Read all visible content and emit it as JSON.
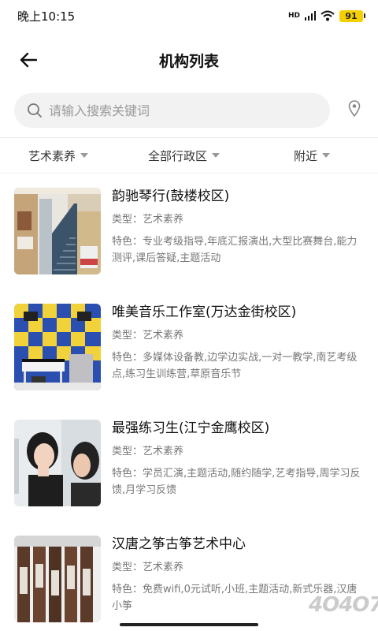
{
  "status_bar": {
    "time": "晚上10:15",
    "network": "HD",
    "battery": "91"
  },
  "header": {
    "title": "机构列表"
  },
  "search": {
    "placeholder": "请输入搜索关键词",
    "value": ""
  },
  "filters": [
    {
      "label": "艺术素养"
    },
    {
      "label": "全部行政区"
    },
    {
      "label": "附近"
    }
  ],
  "institutions": [
    {
      "name": "韵驰琴行(鼓楼校区)",
      "type": "类型：艺术素养",
      "features": "特色：专业考级指导,年底汇报演出,大型比赛舞台,能力测评,课后答疑,主题活动"
    },
    {
      "name": "唯美音乐工作室(万达金街校区)",
      "type": "类型：艺术素养",
      "features": "特色：多媒体设备教,边学边实战,一对一教学,南艺考级点,练习生训练营,草原音乐节"
    },
    {
      "name": "最强练习生(江宁金鹰校区)",
      "type": "类型：艺术素养",
      "features": "特色：学员汇演,主题活动,随约随学,艺考指导,周学习反馈,月学习反馈"
    },
    {
      "name": "汉唐之筝古筝艺术中心",
      "type": "类型：艺术素养",
      "features": "特色：免费wifi,0元试听,小班,主题活动,新式乐器,汉唐小筝"
    }
  ],
  "watermark": "4O4O7",
  "colors": {
    "search_bg": "#f2f2f2",
    "divider": "#eeeeee",
    "battery": "#f5d000",
    "secondary_text": "#777777"
  }
}
